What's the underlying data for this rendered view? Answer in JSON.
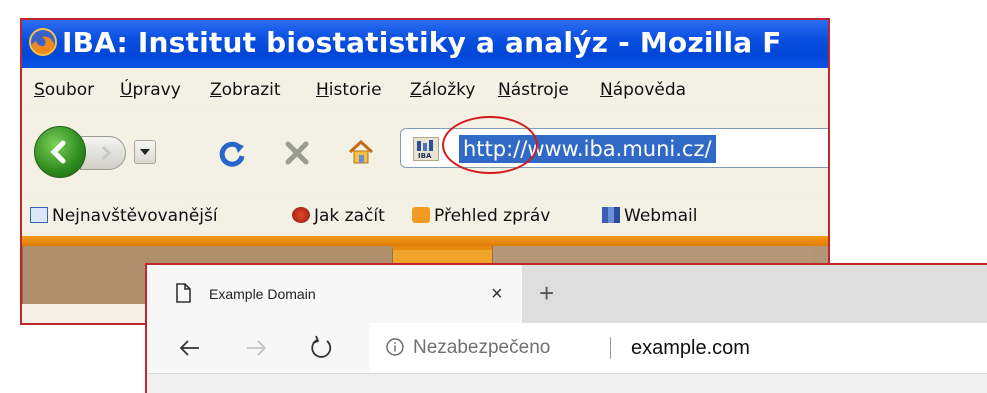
{
  "old_browser": {
    "window_title": "IBA: Institut biostatistiky a analýz - Mozilla F",
    "menu": [
      "Soubor",
      "Úpravy",
      "Zobrazit",
      "Historie",
      "Záložky",
      "Nástroje",
      "Nápověda"
    ],
    "url": "http://www.iba.muni.cz/",
    "bookmarks": [
      {
        "label": "Nejnavštěvovanější",
        "icon": "folder-bookmark-icon"
      },
      {
        "label": "Jak začít",
        "icon": "firefox-red-icon"
      },
      {
        "label": "Přehled zpráv",
        "icon": "rss-feed-icon"
      },
      {
        "label": "Webmail",
        "icon": "cba-site-icon"
      }
    ],
    "colors": {
      "titlebar": "#0046d8",
      "url_highlight": "#3169c6",
      "annotation": "#d21c1c",
      "accent_strip": "#e07d08"
    }
  },
  "new_browser": {
    "tab_title": "Example Domain",
    "tab_close": "×",
    "new_tab": "+",
    "security_label": "Nezabezpečeno",
    "url": "example.com",
    "colors": {
      "frame": "#c0272d",
      "tabbar": "#dedede"
    }
  }
}
